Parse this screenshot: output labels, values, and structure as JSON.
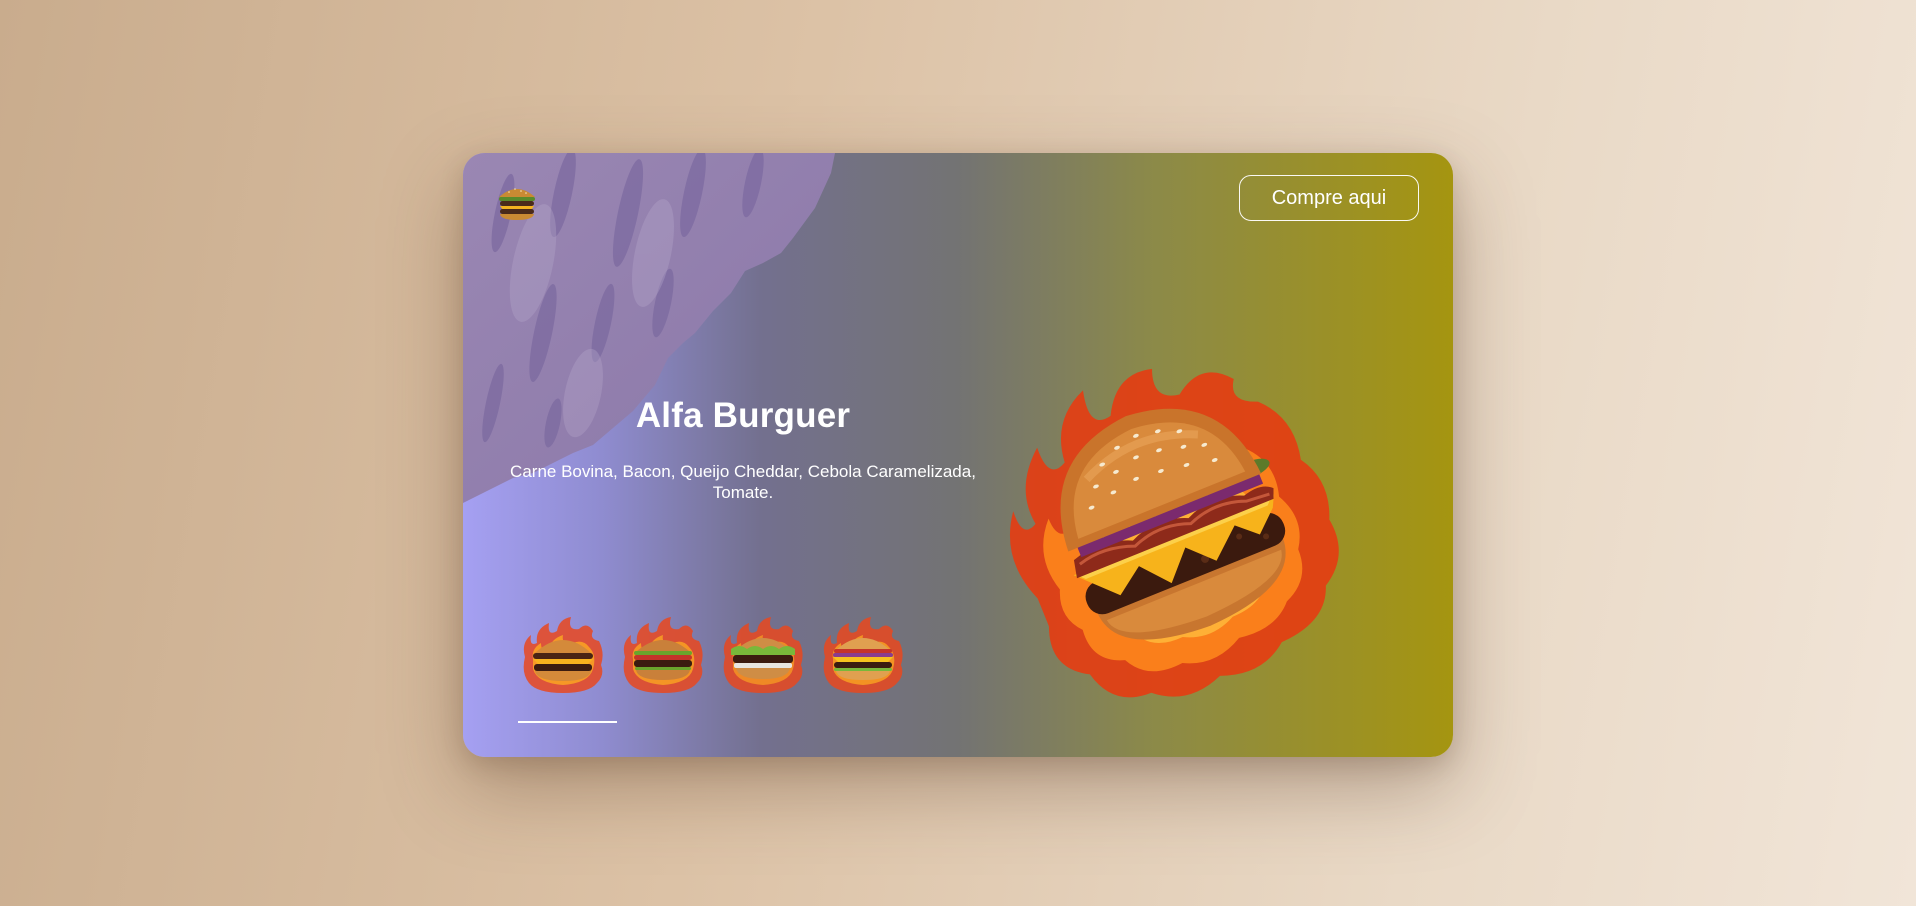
{
  "header": {
    "logo_icon": "burger-logo-icon",
    "buy_label": "Compre aqui"
  },
  "product": {
    "title": "Alfa Burguer",
    "description": "Carne Bovina, Bacon, Queijo Cheddar, Cebola Caramelizada, Tomate.",
    "hero_icon": "flaming-burger-image"
  },
  "thumbnails": [
    {
      "icon": "burger-thumbnail-1",
      "selected": true
    },
    {
      "icon": "burger-thumbnail-2",
      "selected": false
    },
    {
      "icon": "burger-thumbnail-3",
      "selected": false
    },
    {
      "icon": "burger-thumbnail-4",
      "selected": false
    }
  ],
  "colors": {
    "page_bg_start": "#c9ac8d",
    "page_bg_end": "#f1e5d8",
    "card_left": "#a5a0f2",
    "card_right": "#a59510",
    "text": "#ffffff"
  }
}
